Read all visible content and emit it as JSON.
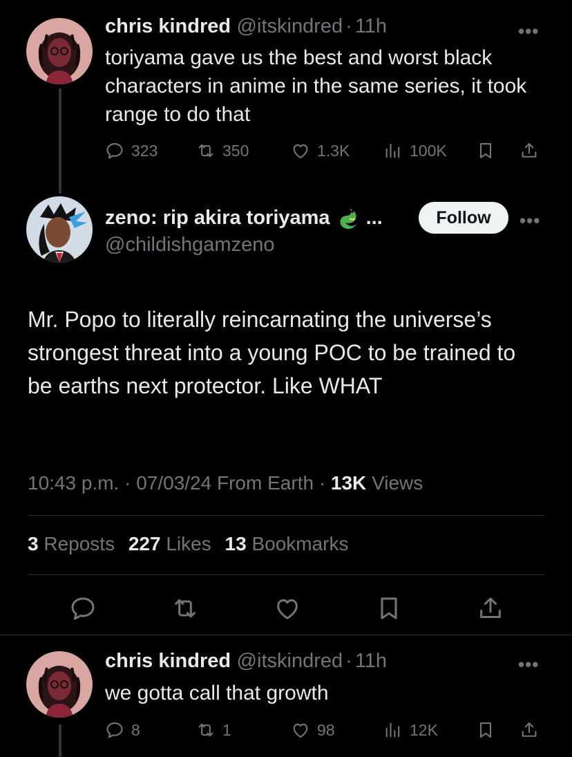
{
  "tweet1": {
    "name": "chris kindred",
    "handle": "@itskindred",
    "sep": "·",
    "time": "11h",
    "text": "toriyama gave us the best and worst black characters in anime in the same series, it took range to do that",
    "replies": "323",
    "reposts": "350",
    "likes": "1.3K",
    "views": "100K"
  },
  "main": {
    "name": "zeno: rip akira toriyama",
    "name_suffix": "...",
    "handle": "@childishgamzeno",
    "follow_label": "Follow",
    "text": "Mr. Popo to literally reincarnating the universe’s strongest threat into a young POC to be trained to be earths next protector. Like WHAT",
    "time": "10:43 p.m.",
    "date": "07/03/24",
    "source": "From Earth",
    "sep": "·",
    "views_count": "13K",
    "views_label": "Views",
    "reposts_count": "3",
    "reposts_label": "Reposts",
    "likes_count": "227",
    "likes_label": "Likes",
    "bookmarks_count": "13",
    "bookmarks_label": "Bookmarks"
  },
  "tweet3": {
    "name": "chris kindred",
    "handle": "@itskindred",
    "sep": "·",
    "time": "11h",
    "text": "we gotta call that growth",
    "replies": "8",
    "reposts": "1",
    "likes": "98",
    "views": "12K"
  },
  "more_label": "•••",
  "icons": [
    "reply-icon",
    "repost-icon",
    "like-icon",
    "views-icon",
    "bookmark-icon",
    "share-icon",
    "more-icon",
    "dragon-emoji-icon"
  ]
}
